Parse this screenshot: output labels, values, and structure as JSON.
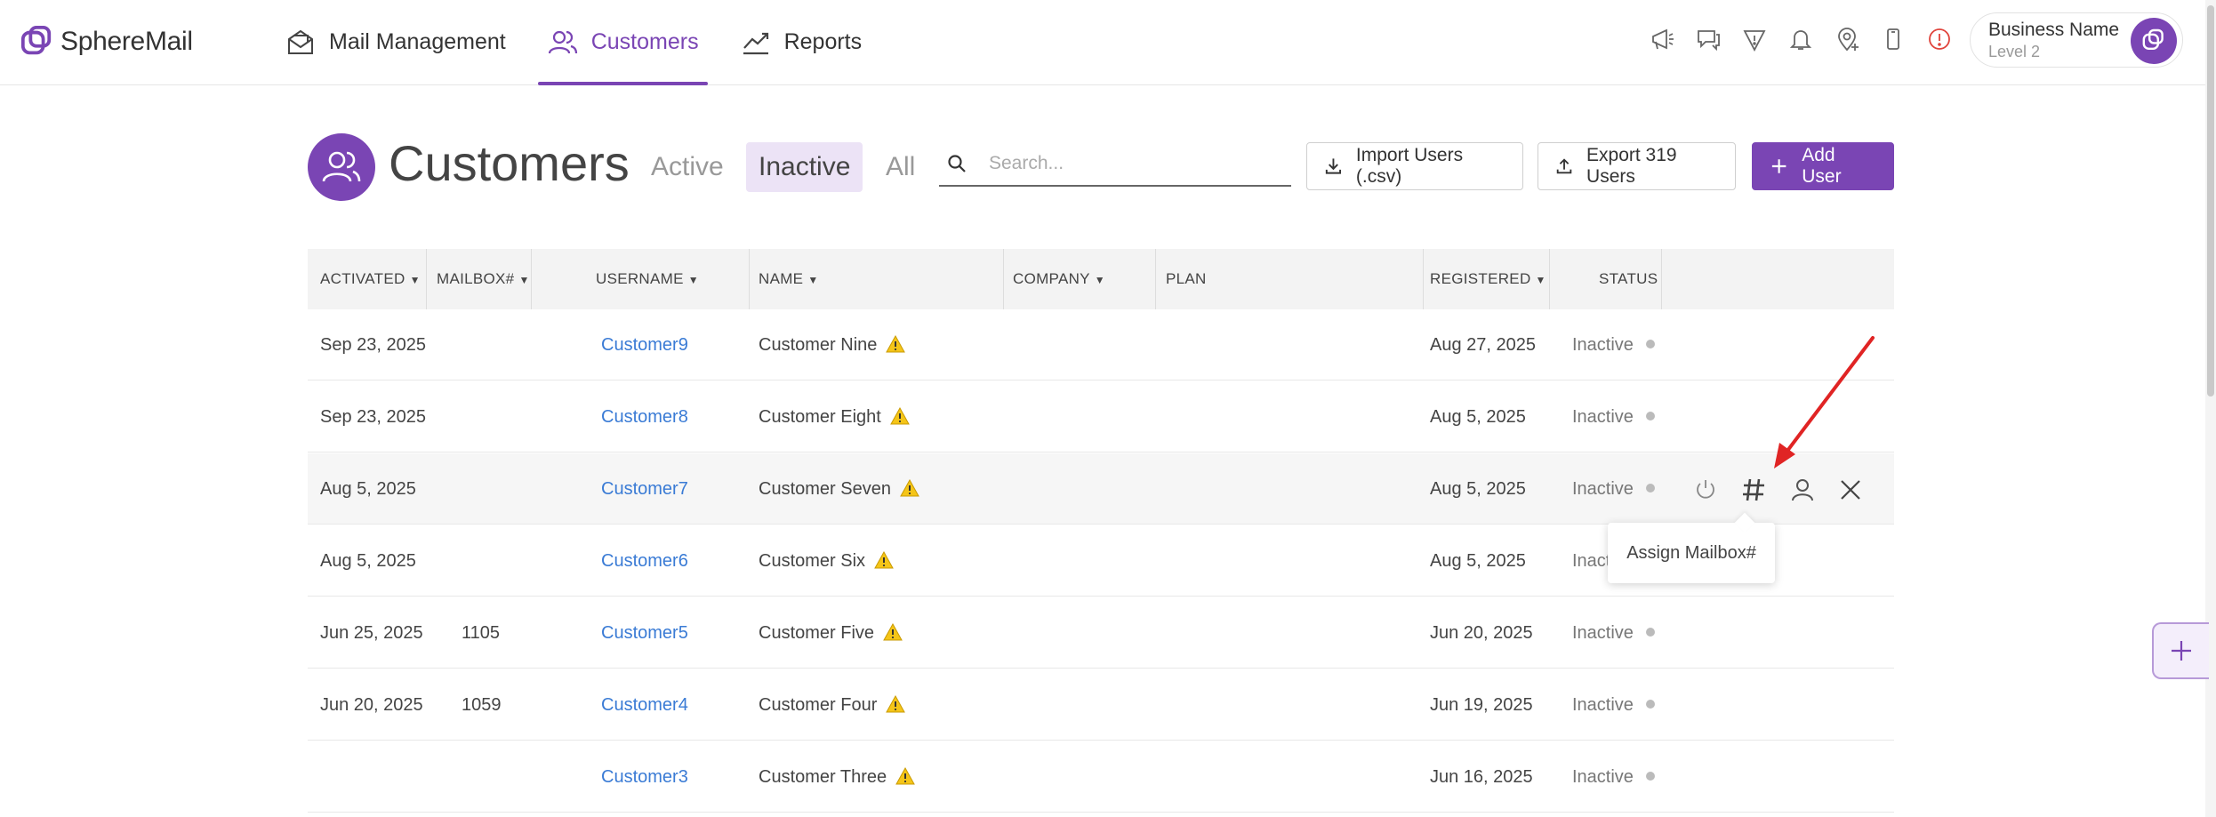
{
  "app": {
    "logo_text": "SphereMail",
    "brand_color": "#7a45b4",
    "nav": [
      {
        "label": "Mail Management",
        "icon": "envelope-icon"
      },
      {
        "label": "Customers",
        "icon": "users-icon",
        "active": true
      },
      {
        "label": "Reports",
        "icon": "chart-line-icon"
      }
    ],
    "utility_icons": [
      "megaphone-icon",
      "chat-icon",
      "shield-icon",
      "bell-icon",
      "location-plus-icon",
      "device-icon",
      "alert-icon"
    ],
    "business": {
      "name": "Business Name",
      "level": "Level 2"
    }
  },
  "page": {
    "title": "Customers",
    "filters": [
      "Active",
      "Inactive",
      "All"
    ],
    "active_filter": "Inactive",
    "search_placeholder": "Search...",
    "buttons": {
      "import": "Import Users (.csv)",
      "export": "Export 319 Users",
      "add": "Add User"
    }
  },
  "table": {
    "columns": [
      "ACTIVATED",
      "MAILBOX#",
      "USERNAME",
      "NAME",
      "COMPANY",
      "PLAN",
      "REGISTERED",
      "STATUS"
    ],
    "rows": [
      {
        "activated": "Sep 23, 2025",
        "mailbox": "",
        "username": "Customer9",
        "name": "Customer Nine",
        "company": "",
        "plan": "",
        "registered": "Aug 27, 2025",
        "status": "Inactive"
      },
      {
        "activated": "Sep 23, 2025",
        "mailbox": "",
        "username": "Customer8",
        "name": "Customer Eight",
        "company": "",
        "plan": "",
        "registered": "Aug 5, 2025",
        "status": "Inactive"
      },
      {
        "activated": "Aug 5, 2025",
        "mailbox": "",
        "username": "Customer7",
        "name": "Customer Seven",
        "company": "",
        "plan": "",
        "registered": "Aug 5, 2025",
        "status": "Inactive"
      },
      {
        "activated": "Aug 5, 2025",
        "mailbox": "",
        "username": "Customer6",
        "name": "Customer Six",
        "company": "",
        "plan": "",
        "registered": "Aug 5, 2025",
        "status": "Inact"
      },
      {
        "activated": "Jun 25, 2025",
        "mailbox": "1105",
        "username": "Customer5",
        "name": "Customer Five",
        "company": "",
        "plan": "",
        "registered": "Jun 20, 2025",
        "status": "Inactive"
      },
      {
        "activated": "Jun 20, 2025",
        "mailbox": "1059",
        "username": "Customer4",
        "name": "Customer Four",
        "company": "",
        "plan": "",
        "registered": "Jun 19, 2025",
        "status": "Inactive"
      },
      {
        "activated": "",
        "mailbox": "",
        "username": "Customer3",
        "name": "Customer Three",
        "company": "",
        "plan": "",
        "registered": "Jun 16, 2025",
        "status": "Inactive"
      }
    ],
    "row_actions": [
      "power-icon",
      "hash-icon",
      "user-icon",
      "close-icon"
    ],
    "tooltip": "Assign Mailbox#",
    "arrow_color": "#e02424"
  }
}
